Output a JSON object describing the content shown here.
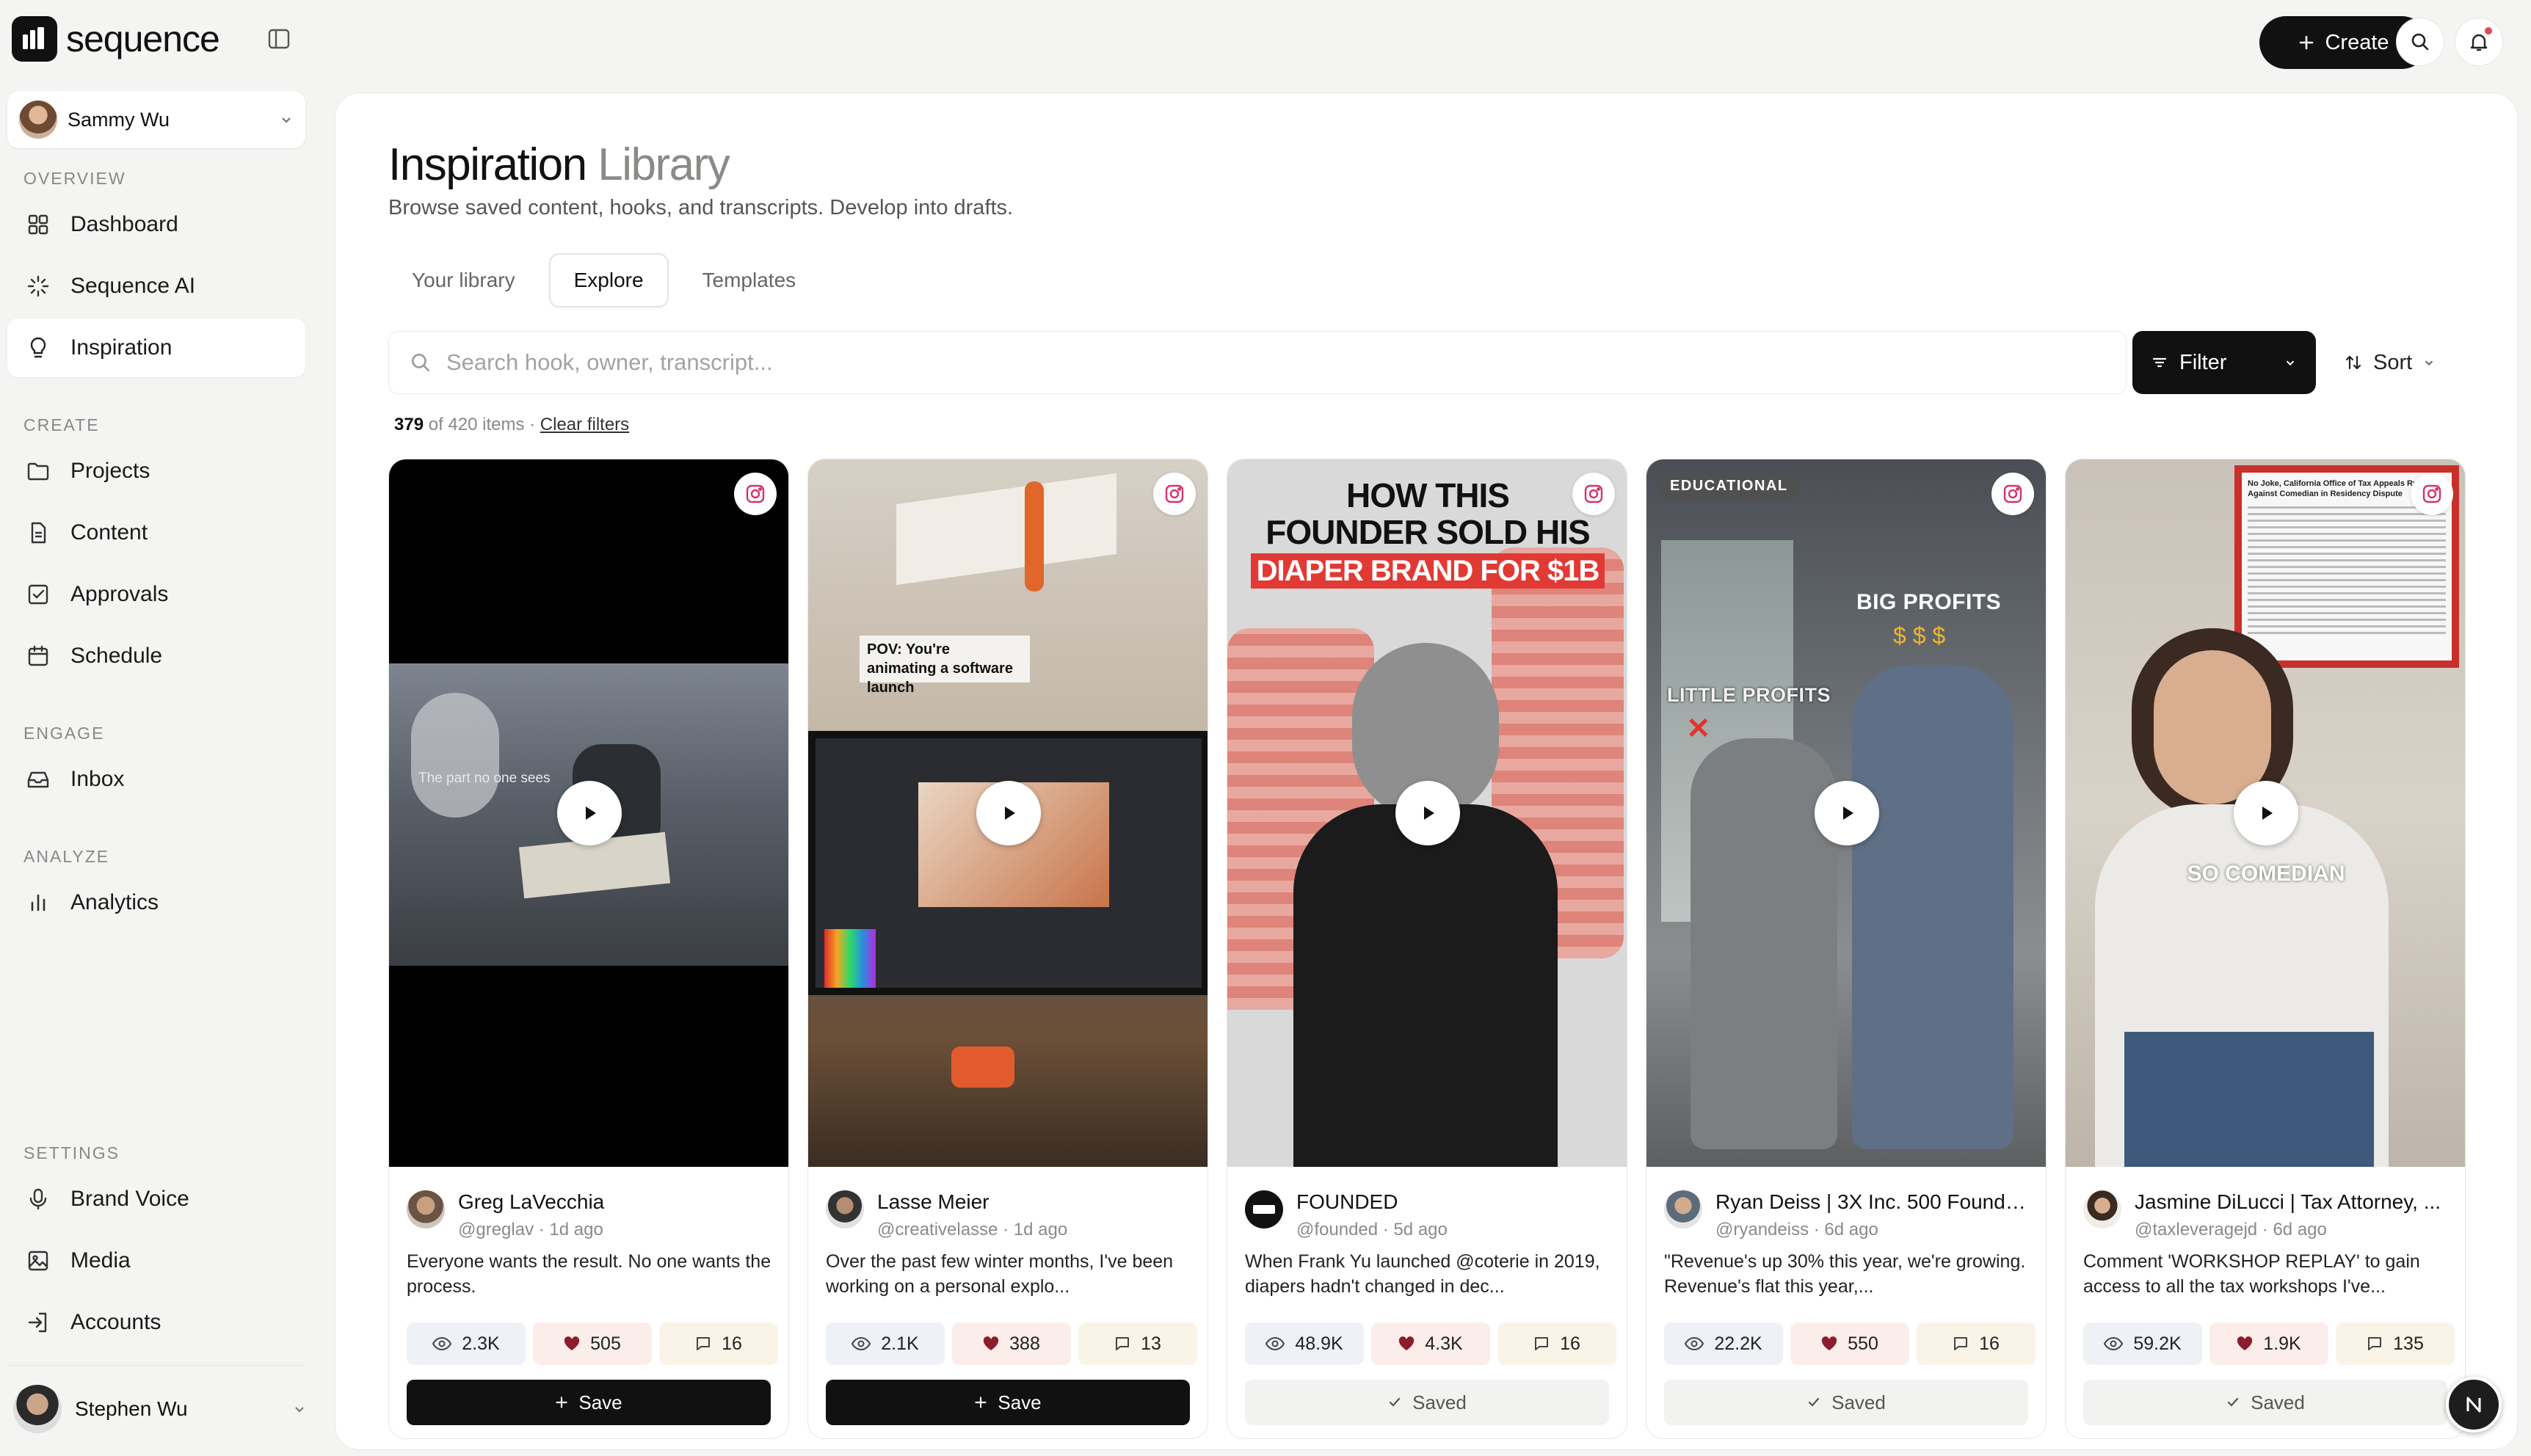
{
  "app": {
    "name": "sequence"
  },
  "workspace": {
    "name": "Sammy Wu"
  },
  "sidebar": {
    "sections": {
      "overview": "OVERVIEW",
      "create": "CREATE",
      "engage": "ENGAGE",
      "analyze": "ANALYZE",
      "settings": "SETTINGS"
    },
    "items": [
      {
        "label": "Dashboard",
        "icon": "grid-icon"
      },
      {
        "label": "Sequence AI",
        "icon": "sparkle-icon"
      },
      {
        "label": "Inspiration",
        "icon": "lightbulb-icon",
        "active": true
      },
      {
        "label": "Projects",
        "icon": "folder-icon"
      },
      {
        "label": "Content",
        "icon": "file-icon"
      },
      {
        "label": "Approvals",
        "icon": "checkbox-icon"
      },
      {
        "label": "Schedule",
        "icon": "calendar-icon"
      },
      {
        "label": "Inbox",
        "icon": "inbox-icon"
      },
      {
        "label": "Analytics",
        "icon": "bar-chart-icon"
      },
      {
        "label": "Brand Voice",
        "icon": "mic-icon"
      },
      {
        "label": "Media",
        "icon": "image-icon"
      },
      {
        "label": "Accounts",
        "icon": "login-icon"
      }
    ],
    "user": {
      "name": "Stephen Wu"
    }
  },
  "topbar": {
    "create_label": "Create"
  },
  "page": {
    "title_main": "Inspiration",
    "title_dim": "Library",
    "subtitle": "Browse saved content, hooks, and transcripts. Develop into drafts.",
    "tabs": [
      "Your library",
      "Explore",
      "Templates"
    ],
    "active_tab": "Explore",
    "search_placeholder": "Search hook, owner, transcript...",
    "filter_label": "Filter",
    "sort_label": "Sort",
    "count_shown": "379",
    "count_rest": "of 420 items ·",
    "clear_filters": "Clear filters"
  },
  "cards": [
    {
      "owner": "Greg LaVecchia",
      "handle": "@greglav",
      "age": "1d ago",
      "caption": "Everyone wants the result. No one wants the process.",
      "views": "2.3K",
      "likes": "505",
      "comments": "16",
      "action": "Save",
      "saved": false,
      "platform": "instagram-icon",
      "overlay": "The part no one sees"
    },
    {
      "owner": "Lasse Meier",
      "handle": "@creativelasse",
      "age": "1d ago",
      "caption": "Over the past few winter months, I've been working on a personal explo...",
      "views": "2.1K",
      "likes": "388",
      "comments": "13",
      "action": "Save",
      "saved": false,
      "platform": "instagram-icon",
      "overlay": "POV: You're animating a software launch"
    },
    {
      "owner": "FOUNDED",
      "handle": "@founded",
      "age": "5d ago",
      "caption": "When Frank Yu launched @coterie in 2019, diapers hadn't changed in dec...",
      "views": "48.9K",
      "likes": "4.3K",
      "comments": "16",
      "action": "Saved",
      "saved": true,
      "platform": "instagram-icon",
      "overlay_line1": "HOW THIS",
      "overlay_line2": "FOUNDER SOLD HIS",
      "overlay_line3": "DIAPER BRAND FOR $1B"
    },
    {
      "owner": "Ryan Deiss | 3X Inc. 500 Founde...",
      "handle": "@ryandeiss",
      "age": "6d ago",
      "caption": "\"Revenue's up 30% this year, we're growing. Revenue's flat this year,...",
      "views": "22.2K",
      "likes": "550",
      "comments": "16",
      "action": "Saved",
      "saved": true,
      "platform": "instagram-icon",
      "badge": "EDUCATIONAL",
      "overlay_a": "BIG PROFITS",
      "overlay_b": "LITTLE PROFITS"
    },
    {
      "owner": "Jasmine DiLucci | Tax Attorney, ...",
      "handle": "@taxleveragejd",
      "age": "6d ago",
      "caption": "Comment 'WORKSHOP REPLAY' to gain access to all the tax workshops I've...",
      "views": "59.2K",
      "likes": "1.9K",
      "comments": "135",
      "action": "Saved",
      "saved": true,
      "platform": "instagram-icon",
      "overlay": "SO COMEDIAN",
      "headline": "No Joke, California Office of Tax Appeals Rules Against Comedian in Residency Dispute"
    }
  ]
}
